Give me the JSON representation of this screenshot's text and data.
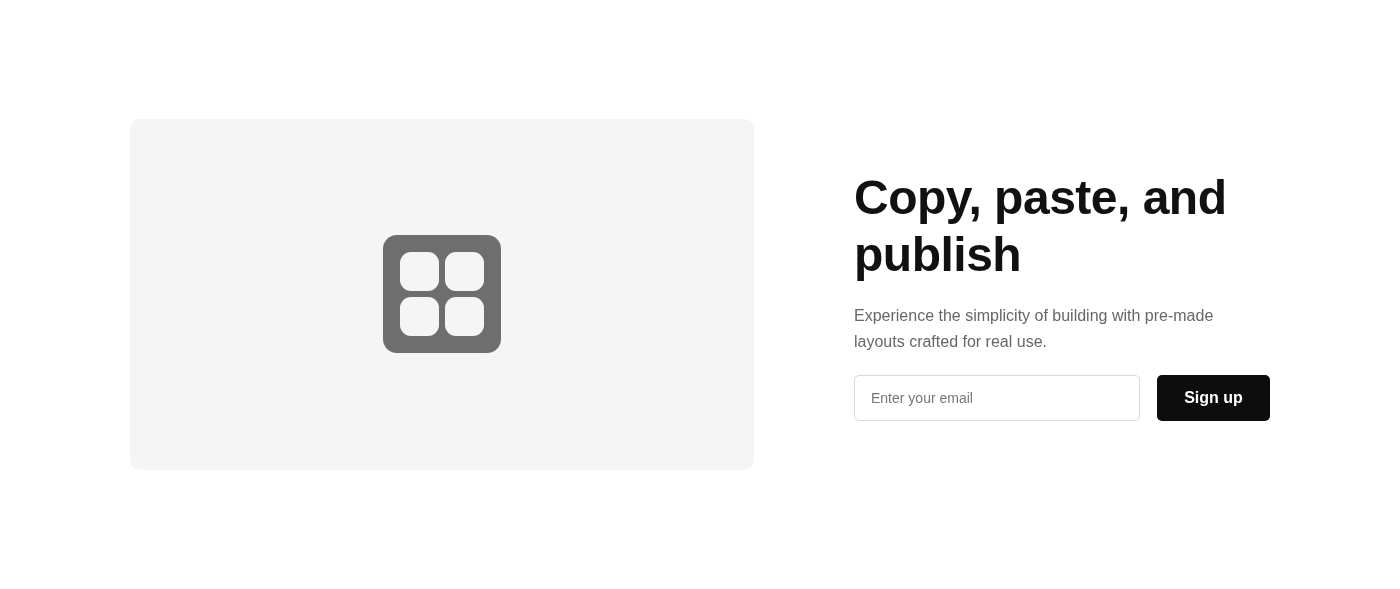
{
  "hero": {
    "heading": "Copy, paste, and publish",
    "description": "Experience the simplicity of building with pre-made layouts crafted for real use.",
    "email_field": {
      "placeholder": "Enter your email"
    },
    "submit_button": {
      "label": "Sign up"
    }
  }
}
